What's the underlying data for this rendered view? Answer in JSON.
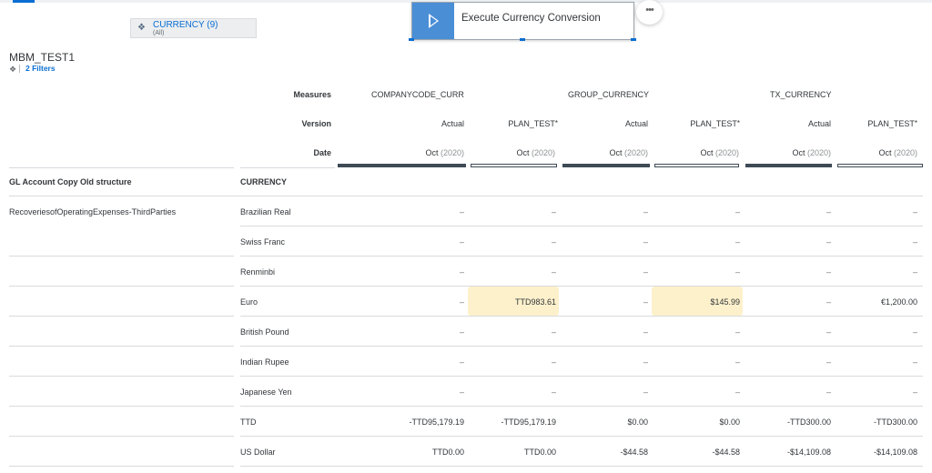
{
  "filter_chip": {
    "title": "CURRENCY (9)",
    "subtitle": "(All)",
    "icon": "cube-icon"
  },
  "execute_button": {
    "label": "Execute Currency Conversion",
    "icon": "play-icon"
  },
  "more_button": {
    "label": "•••"
  },
  "table_title": "MBM_TEST1",
  "filters_link": "2 Filters",
  "header_labels": {
    "measures": "Measures",
    "version": "Version",
    "date": "Date"
  },
  "measures": [
    "COMPANYCODE_CURR",
    "GROUP_CURRENCY",
    "TX_CURRENCY"
  ],
  "columns": [
    {
      "version": "Actual",
      "star": "",
      "month": "Oct",
      "year": "(2020)"
    },
    {
      "version": "PLAN_TEST",
      "star": "*",
      "month": "Oct",
      "year": "(2020)"
    },
    {
      "version": "Actual",
      "star": "",
      "month": "Oct",
      "year": "(2020)"
    },
    {
      "version": "PLAN_TEST",
      "star": "*",
      "month": "Oct",
      "year": "(2020)"
    },
    {
      "version": "Actual",
      "star": "",
      "month": "Oct",
      "year": "(2020)"
    },
    {
      "version": "PLAN_TEST",
      "star": "*",
      "month": "Oct",
      "year": "(2020)"
    }
  ],
  "dimension_headers": {
    "gl_account": "GL Account Copy Old structure",
    "currency": "CURRENCY"
  },
  "gl_account_value": "RecoveriesofOperatingExpenses-ThirdParties",
  "rows": [
    {
      "currency": "Brazilian Real",
      "values": [
        "–",
        "–",
        "–",
        "–",
        "–",
        "–"
      ]
    },
    {
      "currency": "Swiss Franc",
      "values": [
        "–",
        "–",
        "–",
        "–",
        "–",
        "–"
      ]
    },
    {
      "currency": "Renminbi",
      "values": [
        "–",
        "–",
        "–",
        "–",
        "–",
        "–"
      ]
    },
    {
      "currency": "Euro",
      "values": [
        "–",
        "TTD983.61",
        "–",
        "$145.99",
        "–",
        "€1,200.00"
      ]
    },
    {
      "currency": "British Pound",
      "values": [
        "–",
        "–",
        "–",
        "–",
        "–",
        "–"
      ]
    },
    {
      "currency": "Indian Rupee",
      "values": [
        "–",
        "–",
        "–",
        "–",
        "–",
        "–"
      ]
    },
    {
      "currency": "Japanese Yen",
      "values": [
        "–",
        "–",
        "–",
        "–",
        "–",
        "–"
      ]
    },
    {
      "currency": "TTD",
      "values": [
        "-TTD95,179.19",
        "-TTD95,179.19",
        "$0.00",
        "$0.00",
        "-TTD300.00",
        "-TTD300.00"
      ]
    },
    {
      "currency": "US Dollar",
      "values": [
        "TTD0.00",
        "TTD0.00",
        "-$44.58",
        "-$44.58",
        "-$14,109.08",
        "-$14,109.08"
      ]
    }
  ],
  "highlighted_cells": [
    [
      3,
      1
    ],
    [
      3,
      3
    ]
  ],
  "colors": {
    "accent": "#0a6ed1",
    "highlight": "#fdf1cc",
    "header_bar": "#3e4a55"
  }
}
